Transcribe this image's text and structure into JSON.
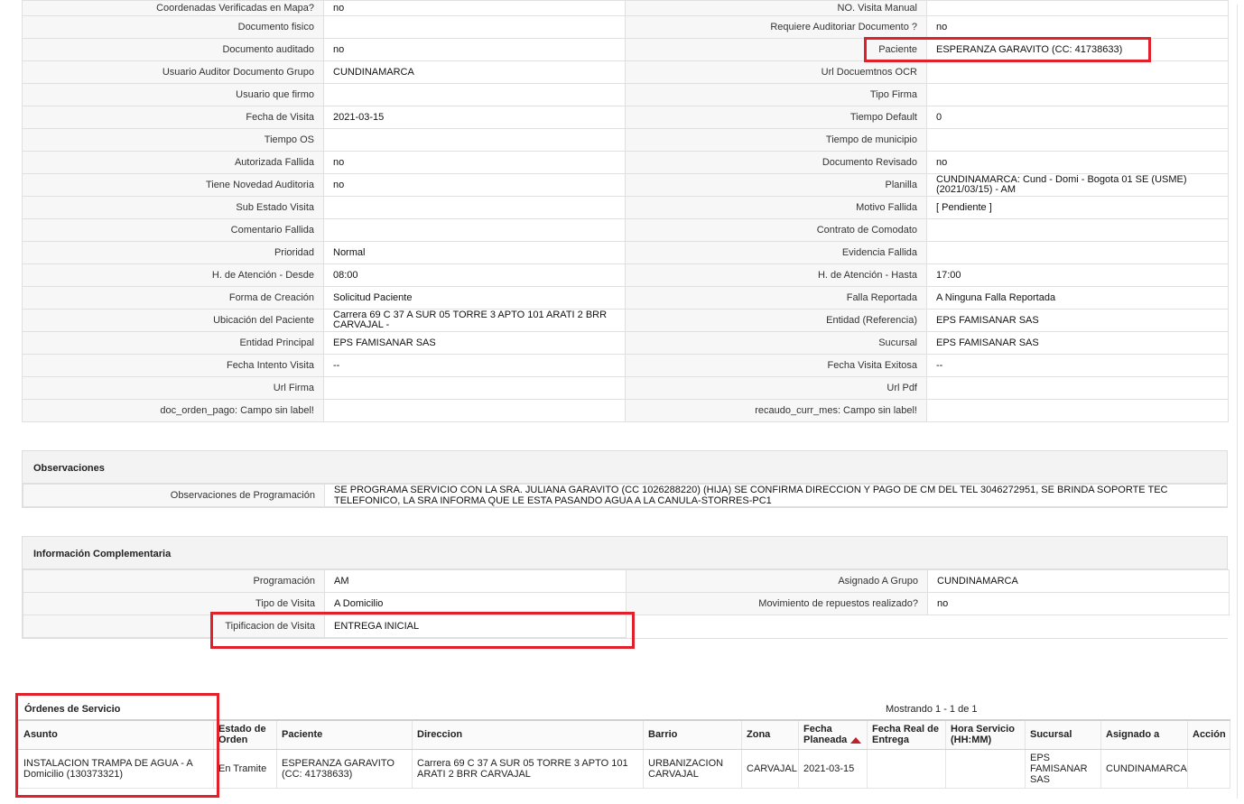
{
  "detail_rows": [
    [
      {
        "label": "Coordenadas Verificadas en Mapa?",
        "value": "no"
      },
      {
        "label": "NO. Visita Manual",
        "value": ""
      }
    ],
    [
      {
        "label": "Documento fisico",
        "value": ""
      },
      {
        "label": "Requiere Auditoriar Documento ?",
        "value": "no"
      }
    ],
    [
      {
        "label": "Documento auditado",
        "value": "no"
      },
      {
        "label": "Paciente",
        "value": "ESPERANZA GARAVITO (CC: 41738633)"
      }
    ],
    [
      {
        "label": "Usuario Auditor Documento Grupo",
        "value": "CUNDINAMARCA"
      },
      {
        "label": "Url Docuemtnos OCR",
        "value": ""
      }
    ],
    [
      {
        "label": "Usuario que firmo",
        "value": ""
      },
      {
        "label": "Tipo Firma",
        "value": ""
      }
    ],
    [
      {
        "label": "Fecha de Visita",
        "value": "2021-03-15"
      },
      {
        "label": "Tiempo Default",
        "value": "0"
      }
    ],
    [
      {
        "label": "Tiempo OS",
        "value": ""
      },
      {
        "label": "Tiempo de municipio",
        "value": ""
      }
    ],
    [
      {
        "label": "Autorizada Fallida",
        "value": "no"
      },
      {
        "label": "Documento Revisado",
        "value": "no"
      }
    ],
    [
      {
        "label": "Tiene Novedad Auditoria",
        "value": "no"
      },
      {
        "label": "Planilla",
        "value": "CUNDINAMARCA: Cund - Domi - Bogota 01 SE (USME) (2021/03/15) - AM"
      }
    ],
    [
      {
        "label": "Sub Estado Visita",
        "value": ""
      },
      {
        "label": "Motivo Fallida",
        "value": "[ Pendiente ]"
      }
    ],
    [
      {
        "label": "Comentario Fallida",
        "value": ""
      },
      {
        "label": "Contrato de Comodato",
        "value": ""
      }
    ],
    [
      {
        "label": "Prioridad",
        "value": "Normal"
      },
      {
        "label": "Evidencia Fallida",
        "value": ""
      }
    ],
    [
      {
        "label": "H. de Atención - Desde",
        "value": "08:00"
      },
      {
        "label": "H. de Atención - Hasta",
        "value": "17:00"
      }
    ],
    [
      {
        "label": "Forma de Creación",
        "value": "Solicitud Paciente"
      },
      {
        "label": "Falla Reportada",
        "value": "A Ninguna Falla Reportada"
      }
    ],
    [
      {
        "label": "Ubicación del Paciente",
        "value": "Carrera 69 C 37 A SUR 05 TORRE 3 APTO 101 ARATI 2 BRR CARVAJAL -"
      },
      {
        "label": "Entidad (Referencia)",
        "value": "EPS FAMISANAR SAS"
      }
    ],
    [
      {
        "label": "Entidad Principal",
        "value": "EPS FAMISANAR SAS"
      },
      {
        "label": "Sucursal",
        "value": "EPS FAMISANAR SAS"
      }
    ],
    [
      {
        "label": "Fecha Intento Visita",
        "value": "--"
      },
      {
        "label": "Fecha Visita Exitosa",
        "value": "--"
      }
    ],
    [
      {
        "label": "Url Firma",
        "value": ""
      },
      {
        "label": "Url Pdf",
        "value": ""
      }
    ],
    [
      {
        "label": "doc_orden_pago: Campo sin label!",
        "value": ""
      },
      {
        "label": "recaudo_curr_mes: Campo sin label!",
        "value": ""
      }
    ]
  ],
  "observaciones": {
    "title": "Observaciones",
    "label": "Observaciones de Programación",
    "value": "  SE PROGRAMA SERVICIO CON LA SRA. JULIANA GARAVITO (CC 1026288220) (HIJA) SE CONFIRMA DIRECCION Y PAGO DE CM DEL TEL 3046272951, SE BRINDA SOPORTE TEC TELEFONICO, LA SRA INFORMA QUE LE ESTA PASANDO AGUA A LA CANULA-STORRES-PC1"
  },
  "info_comp": {
    "title": "Información Complementaria",
    "rows": [
      [
        {
          "label": "Programación",
          "value": "AM"
        },
        {
          "label": "Asignado A Grupo",
          "value": "CUNDINAMARCA"
        }
      ],
      [
        {
          "label": "Tipo de Visita",
          "value": "A Domicilio"
        },
        {
          "label": "Movimiento de repuestos realizado?",
          "value": "no"
        }
      ],
      [
        {
          "label": "Tipificacion de Visita",
          "value": "ENTREGA INICIAL"
        }
      ]
    ]
  },
  "orders": {
    "title": "Órdenes de Servicio",
    "showing": "Mostrando 1 - 1 de 1",
    "columns": [
      "Asunto",
      "Estado de Orden",
      "Paciente",
      "Direccion",
      "Barrio",
      "Zona",
      "Fecha Planeada",
      "Fecha Real de Entrega",
      "Hora Servicio (HH:MM)",
      "Sucursal",
      "Asignado a",
      "Acción"
    ],
    "rows": [
      [
        "INSTALACION TRAMPA DE AGUA - A Domicilio (130373321)",
        "En Tramite",
        "ESPERANZA GARAVITO (CC: 41738633)",
        "Carrera 69 C 37 A SUR 05 TORRE 3 APTO 101 ARATI 2 BRR CARVAJAL",
        "URBANIZACION CARVAJAL",
        "CARVAJAL",
        "2021-03-15",
        "",
        "",
        "EPS FAMISANAR SAS",
        "CUNDINAMARCA",
        ""
      ]
    ]
  },
  "colors": {
    "highlight": "#e0202a"
  }
}
